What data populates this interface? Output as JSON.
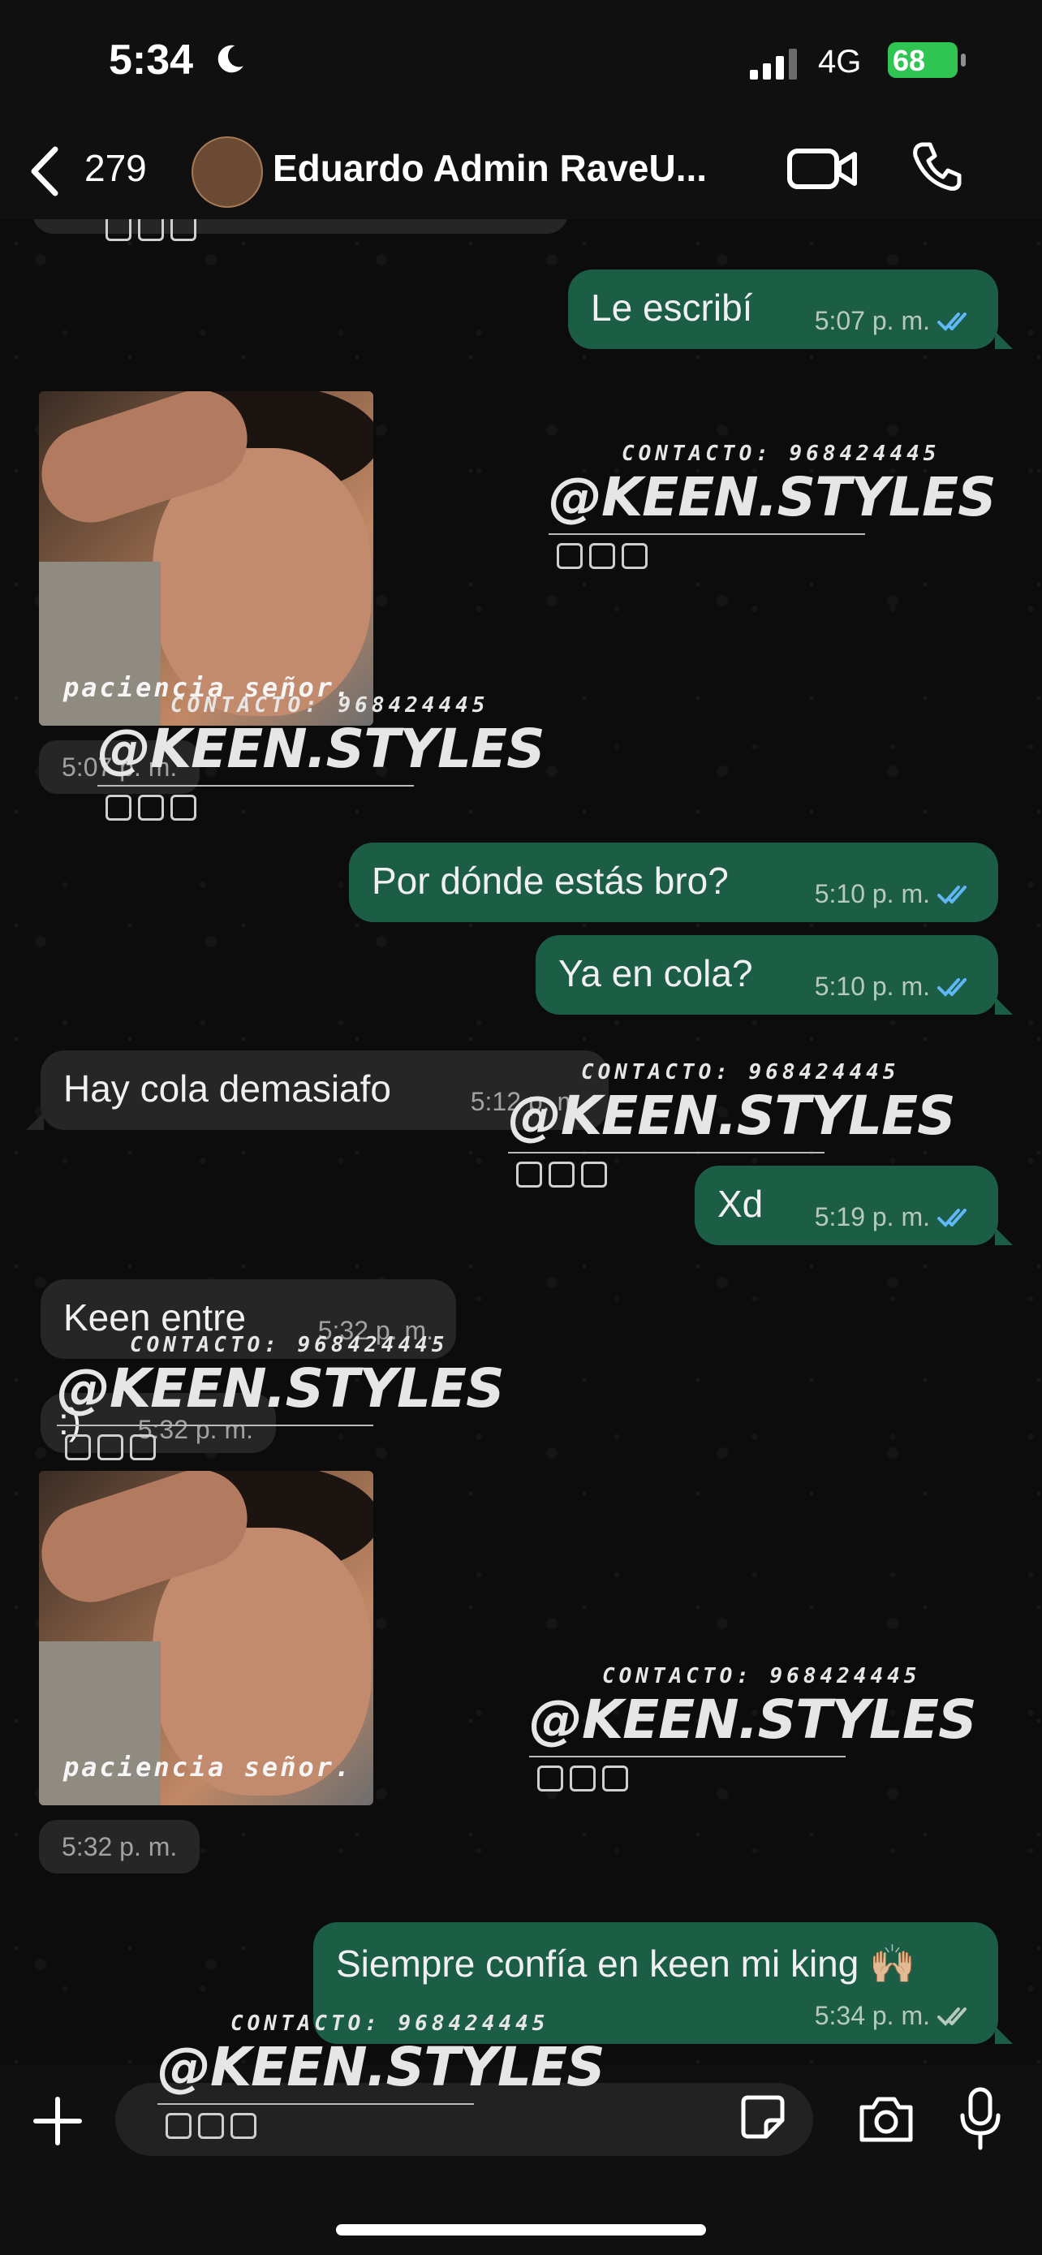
{
  "status_bar": {
    "time": "5:34",
    "network": "4G",
    "battery": "68"
  },
  "header": {
    "back_count": "279",
    "contact_name": "Eduardo Admin RaveU..."
  },
  "messages": [
    {
      "text": "Le escribí",
      "time": "5:07 p. m."
    },
    {
      "photo_caption": "paciencia señor.",
      "time": "5:07 p. m."
    },
    {
      "text": "Por dónde estás bro?",
      "time": "5:10 p. m."
    },
    {
      "text": "Ya en cola?",
      "time": "5:10 p. m."
    },
    {
      "text": "Hay cola demasiafo",
      "time": "5:12 p. m."
    },
    {
      "text": "Xd",
      "time": "5:19 p. m."
    },
    {
      "text": "Keen entre",
      "time": "5:32 p. m."
    },
    {
      "text": ":)",
      "time": "5:32 p. m."
    },
    {
      "photo_caption": "paciencia señor.",
      "time": "5:32 p. m."
    },
    {
      "text": "Siempre confía en keen mi king 🙌🏼",
      "time": "5:34 p. m."
    }
  ],
  "watermark": {
    "contact": "CONTACTO: 968424445",
    "handle": "@KEEN.STYLES"
  },
  "colors": {
    "outgoing_bubble": "#1b5d45",
    "incoming_bubble": "#262626",
    "read_ticks": "#5fb7f5",
    "sent_ticks": "#b6c9c0",
    "battery": "#30c552"
  },
  "icons": [
    "moon-icon",
    "signal-icon",
    "battery-icon",
    "back-chevron-icon",
    "video-camera-icon",
    "phone-icon",
    "double-check-icon",
    "plus-icon",
    "sticker-icon",
    "camera-icon",
    "microphone-icon"
  ]
}
